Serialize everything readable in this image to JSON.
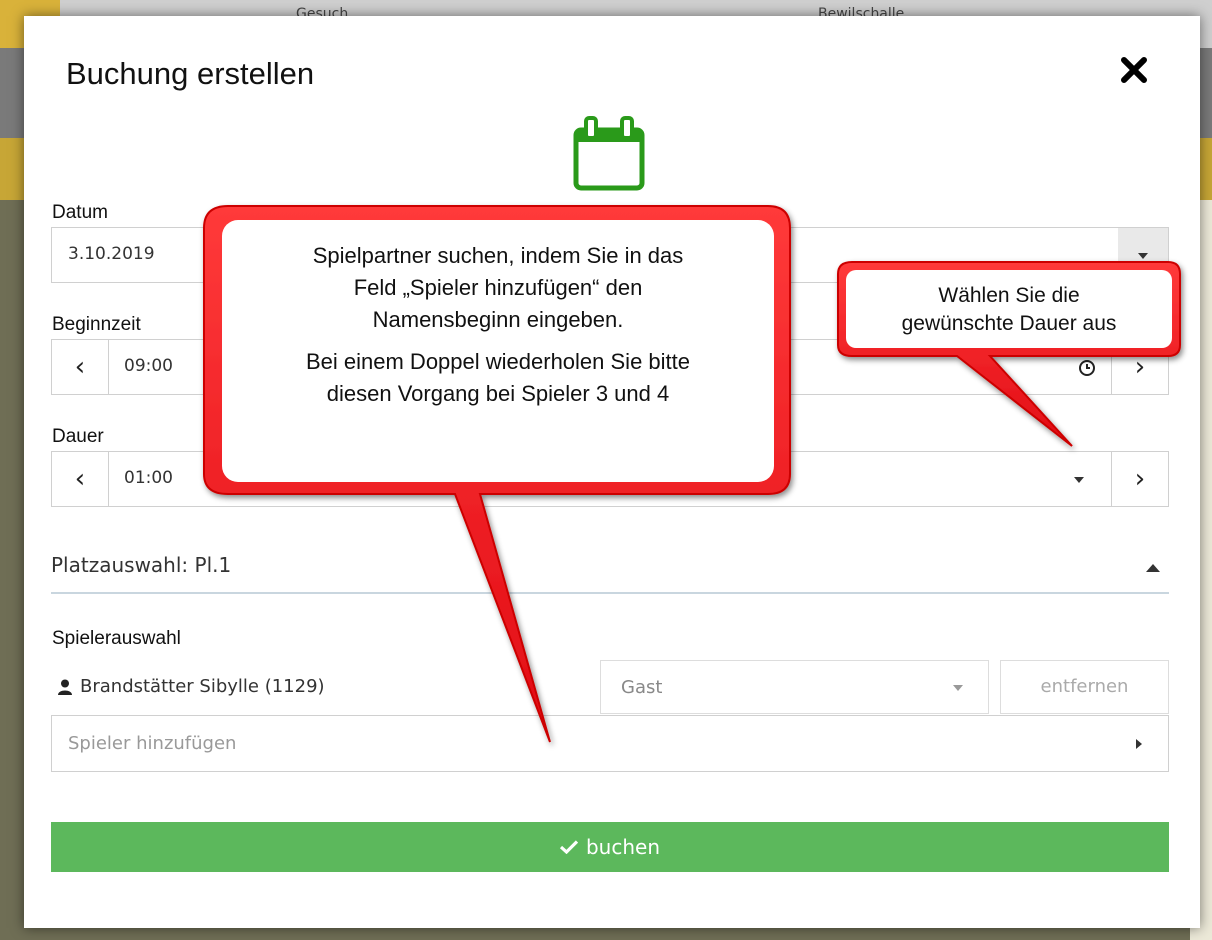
{
  "background": {
    "tab_left": "Gesuch",
    "tab_right": "Bewilschalle"
  },
  "modal": {
    "title": "Buchung erstellen",
    "close_icon": "close-icon",
    "calendar_icon": "calendar-icon",
    "datum": {
      "label": "Datum",
      "value": "3.10.2019"
    },
    "beginnzeit": {
      "label": "Beginnzeit",
      "value": "09:00"
    },
    "dauer": {
      "label": "Dauer",
      "value": "01:00"
    },
    "platzauswahl": "Platzauswahl: Pl.1",
    "spielerauswahl": {
      "label": "Spielerauswahl",
      "player": "Brandstätter Sibylle (1129)",
      "type_select": "Gast",
      "remove_label": "entfernen",
      "add_placeholder": "Spieler hinzufügen"
    },
    "book_label": "buchen"
  },
  "callouts": {
    "search": {
      "line1": "Spielpartner suchen, indem Sie in das",
      "line2": "Feld „Spieler hinzufügen“ den",
      "line3": "Namensbeginn eingeben.",
      "line4": "Bei einem Doppel wiederholen Sie bitte",
      "line5": "diesen Vorgang bei Spieler 3 und 4"
    },
    "duration": {
      "line1": "Wählen Sie die",
      "line2": "gewünschte Dauer aus"
    }
  },
  "colors": {
    "accent_green": "#5cb85c",
    "calendar_green": "#2a9a1a",
    "callout_red": "#e8141c"
  }
}
